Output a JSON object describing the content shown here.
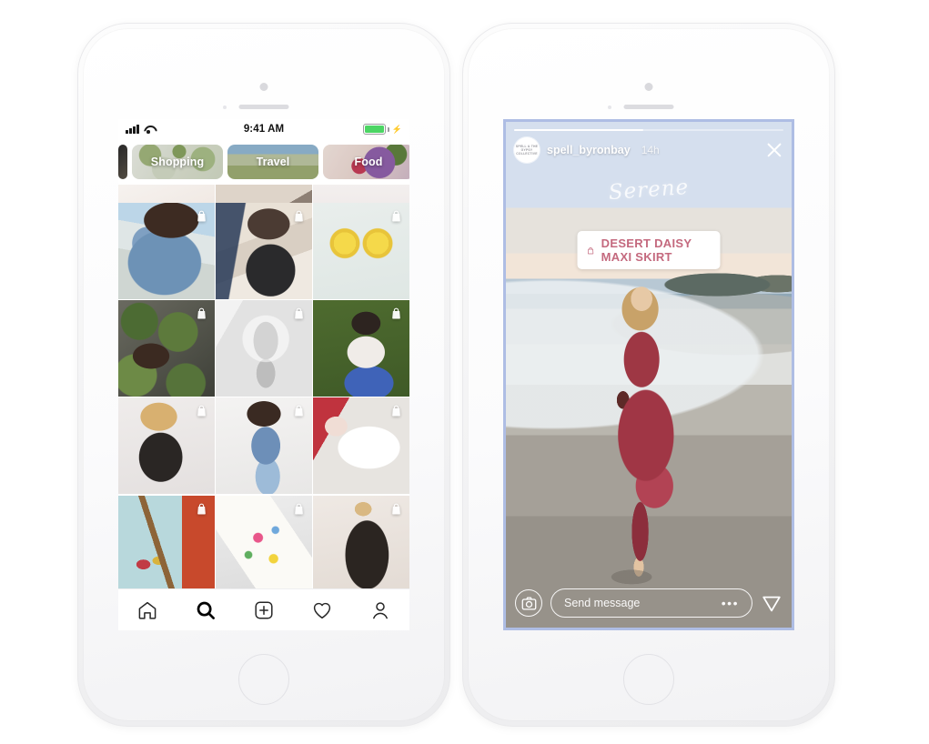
{
  "page": {
    "background": "#ffffff"
  },
  "left_phone": {
    "name": "instagram-explore-shopping",
    "status_bar": {
      "time": "9:41 AM",
      "signal_icon": "cellular-bars-icon",
      "wifi_icon": "wifi-icon",
      "battery_icon": "battery-icon",
      "charging_icon": "lightning-bolt-icon",
      "battery_color": "#4cd564"
    },
    "categories": [
      {
        "label": "Shopping",
        "name": "category-chip-shopping"
      },
      {
        "label": "Travel",
        "name": "category-chip-travel"
      },
      {
        "label": "Food",
        "name": "category-chip-food"
      }
    ],
    "grid": {
      "shopping_tag_icon": "shopping-bag-icon",
      "cut_row": [
        {
          "alt": "hands-light",
          "name": "grid-cell-cut-1"
        },
        {
          "alt": "bed-neutral",
          "name": "grid-cell-cut-2"
        },
        {
          "alt": "skin-pastel",
          "name": "grid-cell-cut-3"
        }
      ],
      "rows": [
        [
          {
            "alt": "denim-jacket-portrait",
            "tagged": true,
            "name": "grid-cell-1-1"
          },
          {
            "alt": "woman-black-dress-portrait",
            "tagged": true,
            "name": "grid-cell-1-2"
          },
          {
            "alt": "daisy-earrings",
            "tagged": true,
            "name": "grid-cell-1-3"
          }
        ],
        [
          {
            "alt": "watermelon-market-watch",
            "tagged": true,
            "name": "grid-cell-2-1"
          },
          {
            "alt": "black-white-seated-portrait",
            "tagged": true,
            "name": "grid-cell-2-2"
          },
          {
            "alt": "woman-on-grass-blue-skirt",
            "tagged": true,
            "name": "grid-cell-2-3"
          }
        ],
        [
          {
            "alt": "graphic-tee-blonde",
            "tagged": true,
            "name": "grid-cell-3-1"
          },
          {
            "alt": "denim-overalls-motion",
            "tagged": true,
            "name": "grid-cell-3-2"
          },
          {
            "alt": "white-linen-folding",
            "tagged": true,
            "name": "grid-cell-3-3"
          }
        ],
        [
          {
            "alt": "canvas-tote-market",
            "tagged": true,
            "name": "grid-cell-4-1"
          },
          {
            "alt": "floral-phone-case",
            "tagged": true,
            "name": "grid-cell-4-2"
          },
          {
            "alt": "dark-floral-maxi-dress",
            "tagged": true,
            "name": "grid-cell-4-3"
          }
        ]
      ]
    },
    "tab_bar": {
      "active": "search",
      "items": [
        {
          "icon": "home-icon",
          "name": "tab-home",
          "label": "Home"
        },
        {
          "icon": "search-icon",
          "name": "tab-search",
          "label": "Search"
        },
        {
          "icon": "plus-square-icon",
          "name": "tab-create",
          "label": "Create"
        },
        {
          "icon": "heart-icon",
          "name": "tab-activity",
          "label": "Activity"
        },
        {
          "icon": "person-icon",
          "name": "tab-profile",
          "label": "Profile"
        }
      ]
    }
  },
  "right_phone": {
    "name": "instagram-story-shopping",
    "story": {
      "border_color": "#aebde4",
      "progress_percent": 48,
      "avatar_text": "SPELL\n& THE GYPSY\nCOLLECTIVE",
      "username": "spell_byronbay",
      "timestamp": "14h",
      "close_icon": "close-icon",
      "script_overlay": "Serene",
      "product_sticker": {
        "label": "DESERT DAISY MAXI SKIRT",
        "icon": "shopping-bag-icon",
        "text_color": "#c4697e"
      },
      "footer": {
        "camera_icon": "camera-icon",
        "message_placeholder": "Send message",
        "more_icon": "ellipsis-icon",
        "send_icon": "paper-plane-icon"
      }
    }
  }
}
